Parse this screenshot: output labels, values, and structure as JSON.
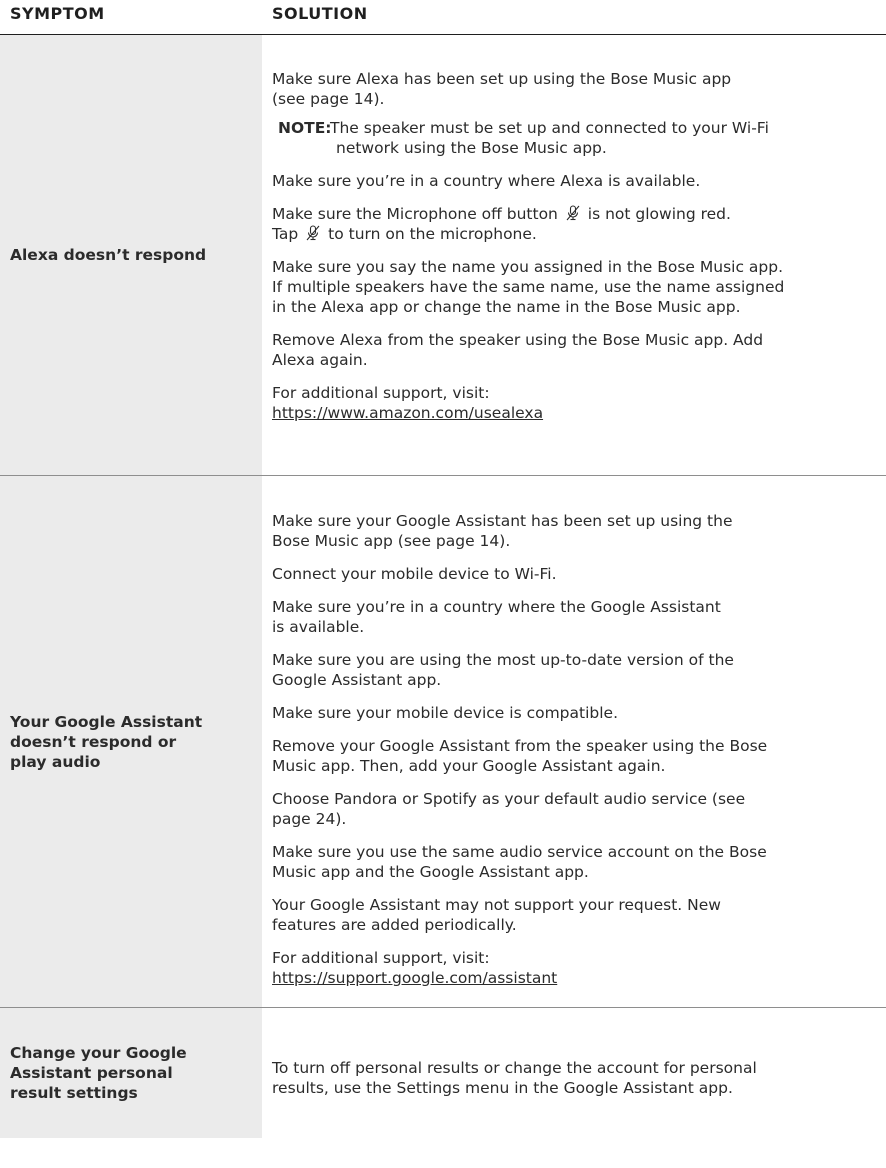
{
  "header": {
    "symptom": "SYMPTOM",
    "solution": "SOLUTION"
  },
  "rows": [
    {
      "symptom": "Alexa doesn’t respond",
      "solutions": {
        "s1_line1": "Make sure Alexa has been set up using the Bose Music app",
        "s1_line2": "(see page 14).",
        "note_label": "NOTE:",
        "note_line1": "The speaker must be set up and connected to your Wi-Fi",
        "note_line2": "network using the Bose Music app.",
        "s2": "Make sure you’re in a country where Alexa is available.",
        "s3_a": "Make sure the Microphone off button",
        "s3_b": "is not glowing red.",
        "s3_c": "Tap",
        "s3_d": "to turn on the microphone.",
        "s4_line1": "Make sure you say the name you assigned in the Bose Music app.",
        "s4_line2": "If multiple speakers have the same name, use the name assigned",
        "s4_line3": "in the Alexa app or change the name in the Bose Music app.",
        "s5_line1": "Remove Alexa from the speaker using the Bose Music app. Add",
        "s5_line2": "Alexa again.",
        "s6_line1": "For additional support, visit:",
        "s6_url": "https://www.amazon.com/usealexa"
      }
    },
    {
      "symptom_line1": "Your Google Assistant",
      "symptom_line2": "doesn’t respond or",
      "symptom_line3": "play audio",
      "solutions": {
        "s1_line1": "Make sure your Google Assistant has been set up using the",
        "s1_line2": "Bose Music app (see page 14).",
        "s2": "Connect your mobile device to Wi-Fi.",
        "s3_line1": "Make sure you’re in a country where the Google Assistant",
        "s3_line2": "is available.",
        "s4_line1": "Make sure you are using the most up-to-date version of the",
        "s4_line2": "Google Assistant app.",
        "s5": "Make sure your mobile device is compatible.",
        "s6_line1": "Remove your Google Assistant from the speaker using the Bose",
        "s6_line2": "Music app. Then, add your Google Assistant again.",
        "s7_line1": "Choose Pandora or Spotify as your default audio service (see",
        "s7_line2": "page 24).",
        "s8_line1": "Make sure you use the same audio service account on the Bose",
        "s8_line2": "Music app and the Google Assistant app.",
        "s9_line1": "Your Google Assistant may not support your request. New",
        "s9_line2": "features are added periodically.",
        "s10_line1": "For additional support, visit:",
        "s10_url": "https://support.google.com/assistant"
      }
    },
    {
      "symptom_line1": "Change your Google",
      "symptom_line2": "Assistant personal",
      "symptom_line3": "result settings",
      "solutions": {
        "s1_line1": "To turn off personal results or change the account for personal",
        "s1_line2": "results, use the Settings menu in the Google Assistant app."
      }
    }
  ],
  "icons": {
    "microphone_off": "microphone-off-icon"
  }
}
